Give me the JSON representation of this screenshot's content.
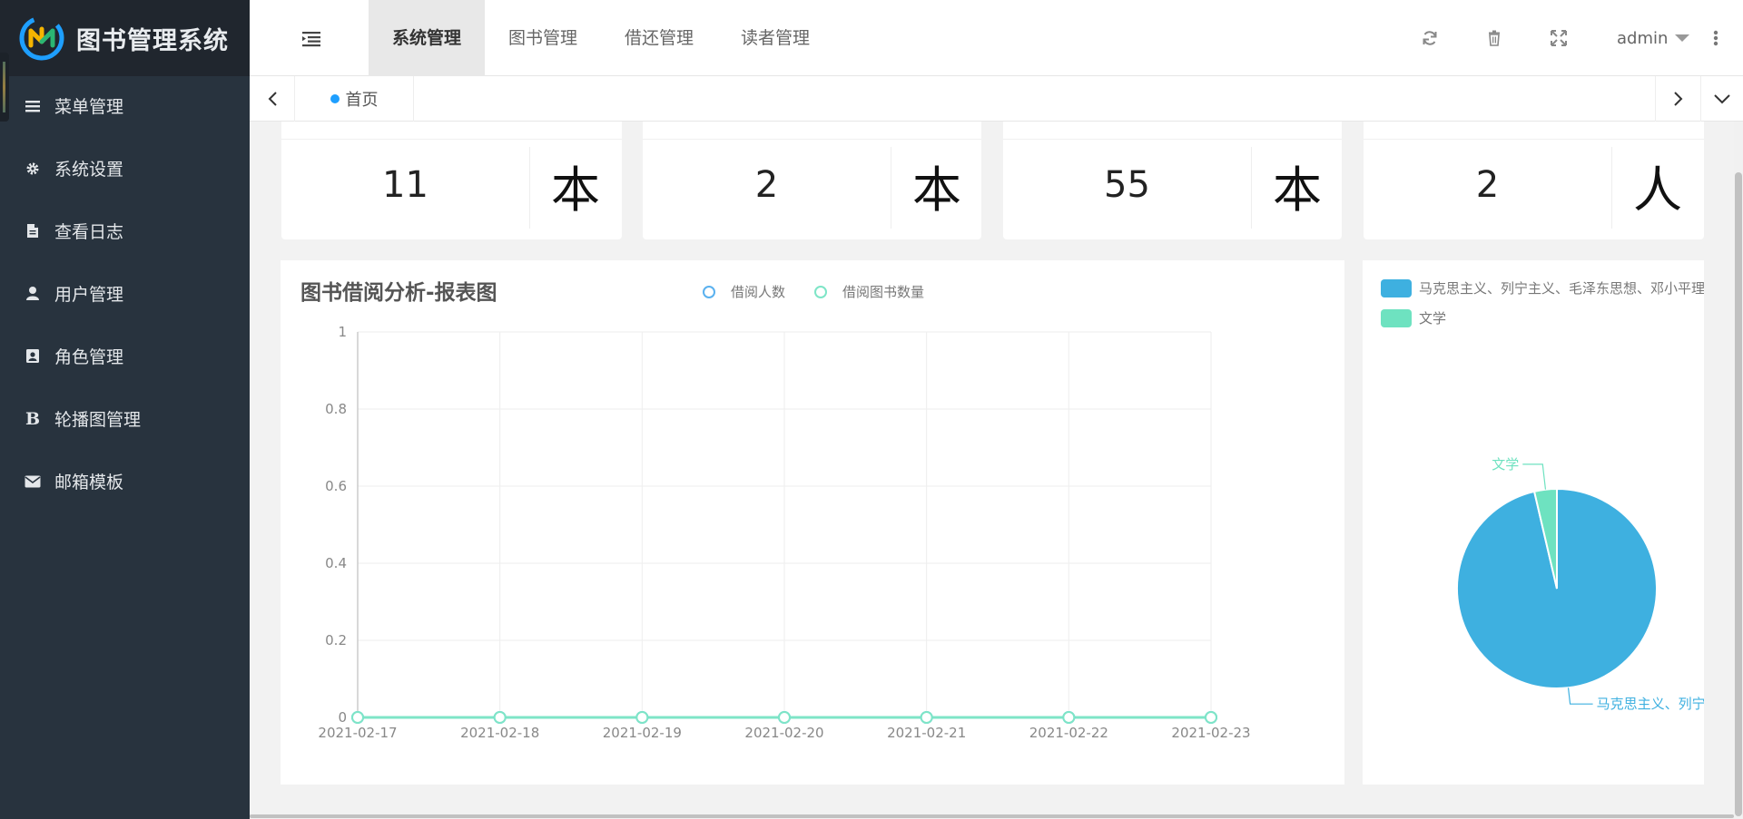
{
  "app": {
    "title": "图书管理系统",
    "colors": {
      "accent": "#1e9fff",
      "sidebar_bg": "#28333e",
      "logo_bg": "#20262e"
    }
  },
  "sidebar": {
    "items": [
      {
        "label": "菜单管理",
        "icon": "list-icon"
      },
      {
        "label": "系统设置",
        "icon": "gear-icon"
      },
      {
        "label": "查看日志",
        "icon": "file-icon"
      },
      {
        "label": "用户管理",
        "icon": "user-icon"
      },
      {
        "label": "角色管理",
        "icon": "contact-card-icon"
      },
      {
        "label": "轮播图管理",
        "icon": "bold-b-icon"
      },
      {
        "label": "邮箱模板",
        "icon": "envelope-icon"
      }
    ]
  },
  "header": {
    "tabs": [
      {
        "label": "系统管理",
        "active": true
      },
      {
        "label": "图书管理",
        "active": false
      },
      {
        "label": "借还管理",
        "active": false
      },
      {
        "label": "读者管理",
        "active": false
      }
    ],
    "user": "admin",
    "icons": [
      "refresh-icon",
      "trash-icon",
      "fullscreen-icon",
      "more-vertical-icon"
    ]
  },
  "tabbar": {
    "home_label": "首页"
  },
  "stats": [
    {
      "value": "11",
      "unit": "本"
    },
    {
      "value": "2",
      "unit": "本"
    },
    {
      "value": "55",
      "unit": "本"
    },
    {
      "value": "2",
      "unit": "人"
    }
  ],
  "line_chart": {
    "title": "图书借阅分析-报表图",
    "legend": [
      {
        "name": "借阅人数",
        "color": "#5ab1ef"
      },
      {
        "name": "借阅图书数量",
        "color": "#7ee5c7"
      }
    ]
  },
  "pie_chart": {
    "legend": [
      {
        "name": "马克思主义、列宁主义、毛泽东思想、邓小平理论",
        "color": "#3eb0e0"
      },
      {
        "name": "文学",
        "color": "#6ee2c0"
      }
    ],
    "slice_labels": {
      "literature": "文学",
      "marxism": "马克思主义、列宁主义、毛泽东思想、邓小平理论"
    }
  },
  "chart_data": [
    {
      "type": "line",
      "title": "图书借阅分析-报表图",
      "x": [
        "2021-02-17",
        "2021-02-18",
        "2021-02-19",
        "2021-02-20",
        "2021-02-21",
        "2021-02-22",
        "2021-02-23"
      ],
      "series": [
        {
          "name": "借阅人数",
          "values": [
            0,
            0,
            0,
            0,
            0,
            0,
            0
          ],
          "color": "#5ab1ef"
        },
        {
          "name": "借阅图书数量",
          "values": [
            0,
            0,
            0,
            0,
            0,
            0,
            0
          ],
          "color": "#7ee5c7"
        }
      ],
      "ylim": [
        0,
        1
      ],
      "yticks": [
        "0",
        "0.2",
        "0.4",
        "0.6",
        "0.8",
        "1"
      ],
      "grid": true,
      "legend_position": "top-center"
    },
    {
      "type": "pie",
      "categories": [
        "马克思主义、列宁主义、毛泽东思想、邓小平理论",
        "文学"
      ],
      "values": [
        53,
        2
      ],
      "colors": [
        "#3eb0e0",
        "#6ee2c0"
      ],
      "legend_position": "top-left"
    }
  ]
}
